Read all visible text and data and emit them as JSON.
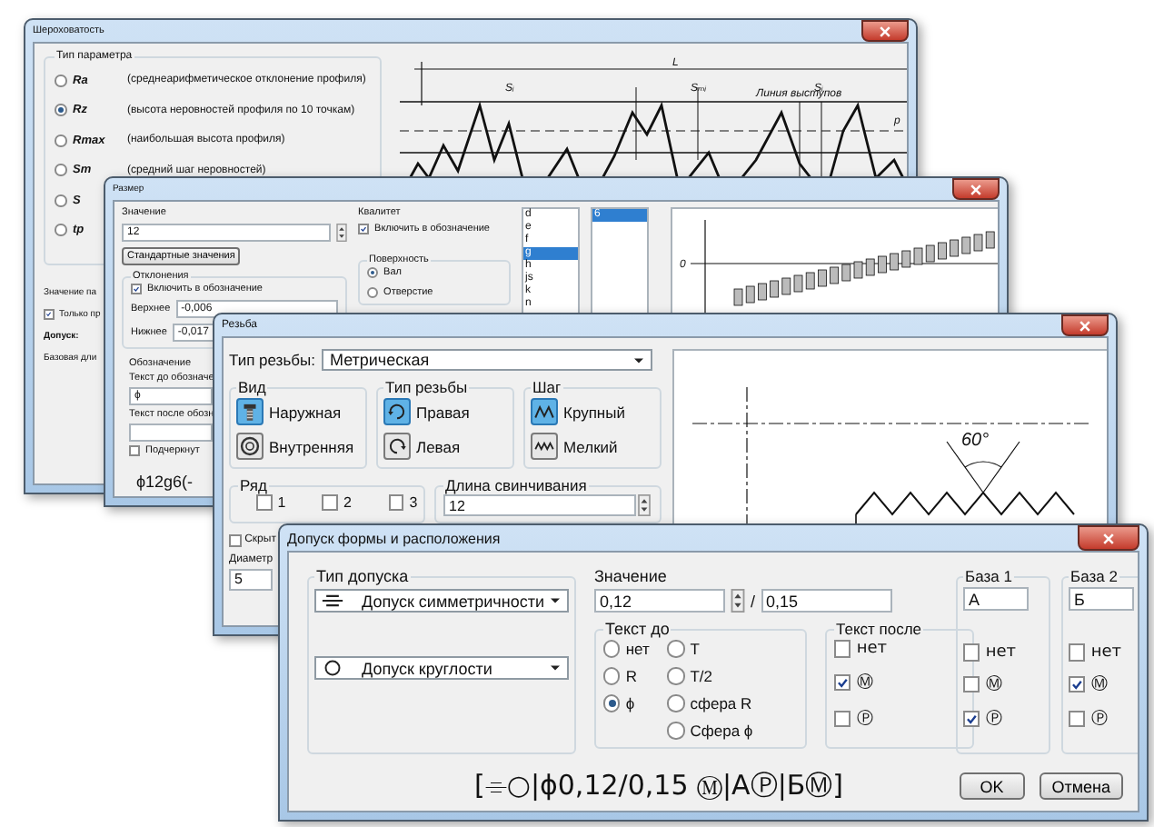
{
  "roughness_dialog": {
    "title": "Шероховатость",
    "parameter_group": {
      "label": "Тип параметра",
      "options": [
        {
          "symbol": "Ra",
          "description": "(среднеарифметическое отклонение профиля)",
          "selected": false
        },
        {
          "symbol": "Rz",
          "description": "(высота неровностей профиля по 10 точкам)",
          "selected": true
        },
        {
          "symbol": "Rmax",
          "description": "(наибольшая высота профиля)",
          "selected": false
        },
        {
          "symbol": "Sm",
          "description": "(средний шаг неровностей)",
          "selected": false
        },
        {
          "symbol": "S",
          "selected": false
        },
        {
          "symbol": "tp",
          "selected": false
        }
      ]
    },
    "value_label": "Значение па",
    "only_checkbox": {
      "label": "Только пр",
      "checked": true
    },
    "tolerance_label": "Допуск:",
    "base_length_label": "Базовая дли",
    "profile_drawing": {
      "labels": [
        "L",
        "Sᵢ",
        "Sₘᵢ",
        "Sᵢ",
        "Линия выступов",
        "p"
      ]
    }
  },
  "size_dialog": {
    "title": "Размер",
    "value_label": "Значение",
    "value": "12",
    "standard_button": "Стандартные значения",
    "deviations": {
      "label": "Отклонения",
      "include": {
        "label": "Включить в обозначение",
        "checked": true
      },
      "upper_label": "Верхнее",
      "upper": "-0,006",
      "lower_label": "Нижнее",
      "lower": "-0,017"
    },
    "designation": {
      "label": "Обозначение",
      "text_before_label": "Текст до обозначе",
      "text_before": "ϕ",
      "text_after_label": "Текст после обозн",
      "underline": {
        "label": "Подчеркнут",
        "checked": false
      }
    },
    "result": "ϕ12g6(-",
    "grade": {
      "label": "Квалитет",
      "include": {
        "label": "Включить в обозначение",
        "checked": true
      }
    },
    "surface": {
      "label": "Поверхность",
      "options": [
        {
          "label": "Вал",
          "selected": true
        },
        {
          "label": "Отверстие",
          "selected": false
        }
      ]
    },
    "deviation_letters": [
      {
        "label": "d",
        "selected": false
      },
      {
        "label": "e",
        "selected": false
      },
      {
        "label": "f",
        "selected": false
      },
      {
        "label": "g",
        "selected": true
      },
      {
        "label": "h",
        "selected": false
      },
      {
        "label": "js",
        "selected": false
      },
      {
        "label": "k",
        "selected": false
      },
      {
        "label": "n",
        "selected": false
      }
    ],
    "grade_numbers": [
      {
        "label": "6",
        "selected": true
      }
    ],
    "tolerance_chart": {
      "labels": [
        "0"
      ]
    }
  },
  "thread_dialog": {
    "title": "Резьба",
    "type_label": "Тип резьбы:",
    "type_value": "Метрическая",
    "groups": [
      {
        "label": "Вид",
        "options": [
          {
            "kind": "external",
            "label": "Наружная",
            "selected": true
          },
          {
            "kind": "internal",
            "label": "Внутренняя",
            "selected": false
          }
        ]
      },
      {
        "label": "Тип резьбы",
        "options": [
          {
            "kind": "right",
            "label": "Правая",
            "selected": true
          },
          {
            "kind": "left",
            "label": "Левая",
            "selected": false
          }
        ]
      },
      {
        "label": "Шаг",
        "options": [
          {
            "kind": "coarse",
            "label": "Крупный",
            "selected": true
          },
          {
            "kind": "fine",
            "label": "Мелкий",
            "selected": false
          }
        ]
      }
    ],
    "row": {
      "label": "Ряд",
      "options": [
        {
          "label": "1",
          "checked": false
        },
        {
          "label": "2",
          "checked": false
        },
        {
          "label": "3",
          "checked": false
        }
      ]
    },
    "length": {
      "label": "Длина свинчивания",
      "value": "12"
    },
    "hidden": {
      "label": "Скрыт",
      "checked": false
    },
    "diameter": {
      "label": "Диаметр",
      "value": "5"
    },
    "thread_drawing": {
      "labels": [
        "60°"
      ]
    }
  },
  "tolerance_dialog": {
    "title": "Допуск формы и расположения",
    "tolerance_type": {
      "label": "Тип допуска",
      "selects": [
        {
          "kind": "symmetry",
          "label": "Допуск симметричности"
        },
        {
          "kind": "roundness",
          "label": "Допуск круглости"
        }
      ]
    },
    "value": {
      "label": "Значение",
      "value": "0,12",
      "separator": "/",
      "value2": "0,15"
    },
    "text_before": {
      "label": "Текст до",
      "options": [
        {
          "label": "нет",
          "selected": false
        },
        {
          "label": "R",
          "selected": false
        },
        {
          "label": "ϕ",
          "selected": true
        },
        {
          "label": "T",
          "selected": false
        },
        {
          "label": "T/2",
          "selected": false
        },
        {
          "label": "сфера R",
          "selected": false
        },
        {
          "label": "Сфера ϕ",
          "selected": false
        }
      ]
    },
    "text_after": {
      "label": "Текст после",
      "options": [
        {
          "label": "нет",
          "checked": false
        },
        {
          "label": "Ⓜ",
          "checked": true
        },
        {
          "label": "Ⓟ",
          "checked": false
        }
      ]
    },
    "bases": [
      {
        "label": "База 1",
        "value": "А",
        "options": [
          {
            "label": "нет",
            "checked": false
          },
          {
            "label": "Ⓜ",
            "checked": false
          },
          {
            "label": "Ⓟ",
            "checked": true
          }
        ]
      },
      {
        "label": "База 2",
        "value": "Б",
        "options": [
          {
            "label": "нет",
            "checked": false
          },
          {
            "label": "Ⓜ",
            "checked": true
          },
          {
            "label": "Ⓟ",
            "checked": false
          }
        ]
      }
    ],
    "result": "[⌯○|ϕ0,12/0,15 Ⓜ|АⓅ|БⓂ]",
    "buttons": [
      "OK",
      "Отмена"
    ]
  }
}
